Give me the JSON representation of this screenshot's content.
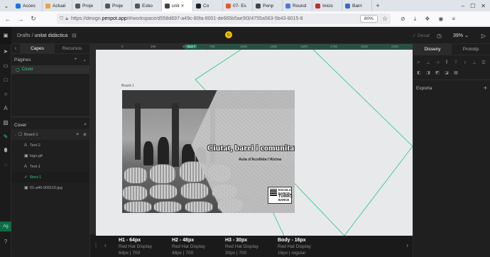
{
  "browser": {
    "tabs": [
      {
        "label": "Acces",
        "color": "#1a73e8",
        "active": false
      },
      {
        "label": "Actual",
        "color": "#e8a33b",
        "active": false
      },
      {
        "label": "Proje",
        "color": "#555555",
        "active": false
      },
      {
        "label": "Proje",
        "color": "#555555",
        "active": false
      },
      {
        "label": "Esbo",
        "color": "#555555",
        "active": false
      },
      {
        "label": "unit",
        "color": "#444444",
        "active": true
      },
      {
        "label": "Co",
        "color": "#222222",
        "active": false
      },
      {
        "label": "07- Es",
        "color": "#e55a2b",
        "active": false
      },
      {
        "label": "Penp",
        "color": "#444444",
        "active": false
      },
      {
        "label": "Round",
        "color": "#4a7bd0",
        "active": false
      },
      {
        "label": "Inicis",
        "color": "#c03030",
        "active": false
      },
      {
        "label": "Barri",
        "color": "#3a6bc4",
        "active": false
      }
    ],
    "new_tab": "+",
    "url_prefix": "https://design.",
    "url_domain": "penpot.app",
    "url_rest": "/#/workspace/d558d697-a49c-80fa-8001-de665b5ae5f3/4755a563-5b43-8015-8",
    "zoom": "80%"
  },
  "header": {
    "breadcrumb_root": "Drafts",
    "breadcrumb_sep": " / ",
    "project": "unitat didàctica",
    "saved_icon": "↻",
    "save_status": "Desat",
    "zoom": "39%"
  },
  "left_panel": {
    "tabs": [
      "Capes",
      "Recursos"
    ],
    "pages_title": "Pàgines",
    "pages": [
      "Cover"
    ],
    "layers_title": "Cover",
    "layers": [
      {
        "name": "Board-1",
        "icon": "☐",
        "level": 0,
        "state": "hl"
      },
      {
        "name": "Text-2",
        "icon": "A",
        "level": 1,
        "state": ""
      },
      {
        "name": "logo.gif",
        "icon": "▣",
        "level": 1,
        "state": ""
      },
      {
        "name": "Text-1",
        "icon": "A",
        "level": 1,
        "state": ""
      },
      {
        "name": "Rect-1",
        "icon": "✓",
        "level": 1,
        "state": "selected"
      },
      {
        "name": "01-a40-009110.jpg",
        "icon": "▣",
        "level": 1,
        "state": ""
      }
    ]
  },
  "canvas": {
    "ruler_ticks": [
      "0",
      "250",
      "500",
      "613.7",
      "750",
      "1000",
      "1250",
      "1500",
      "1750",
      "2000",
      "2250"
    ],
    "board_label": "Board-1",
    "title": "Ciutat, barri i comunitat",
    "subtitle": "Aula d'Acollida l'Alzina",
    "qr_text": [
      "ESCOLA",
      "BARCEL",
      "TURRÓ",
      "BARCE"
    ],
    "guide_color": "#1ec78a"
  },
  "typography": [
    {
      "name": "H1 - 64px",
      "font": "Red Hat Display",
      "meta": "64px | 700"
    },
    {
      "name": "H2 - 48px",
      "font": "Red Hat Display",
      "meta": "48px | 700"
    },
    {
      "name": "H3 - 30px",
      "font": "Red Hat Display",
      "meta": "30px | 700"
    },
    {
      "name": "Body - 16px",
      "font": "Red Hat Display",
      "meta": "16px | regular"
    }
  ],
  "right_panel": {
    "tabs": [
      "Disseny",
      "Prototip"
    ],
    "export_title": "Exporta"
  }
}
